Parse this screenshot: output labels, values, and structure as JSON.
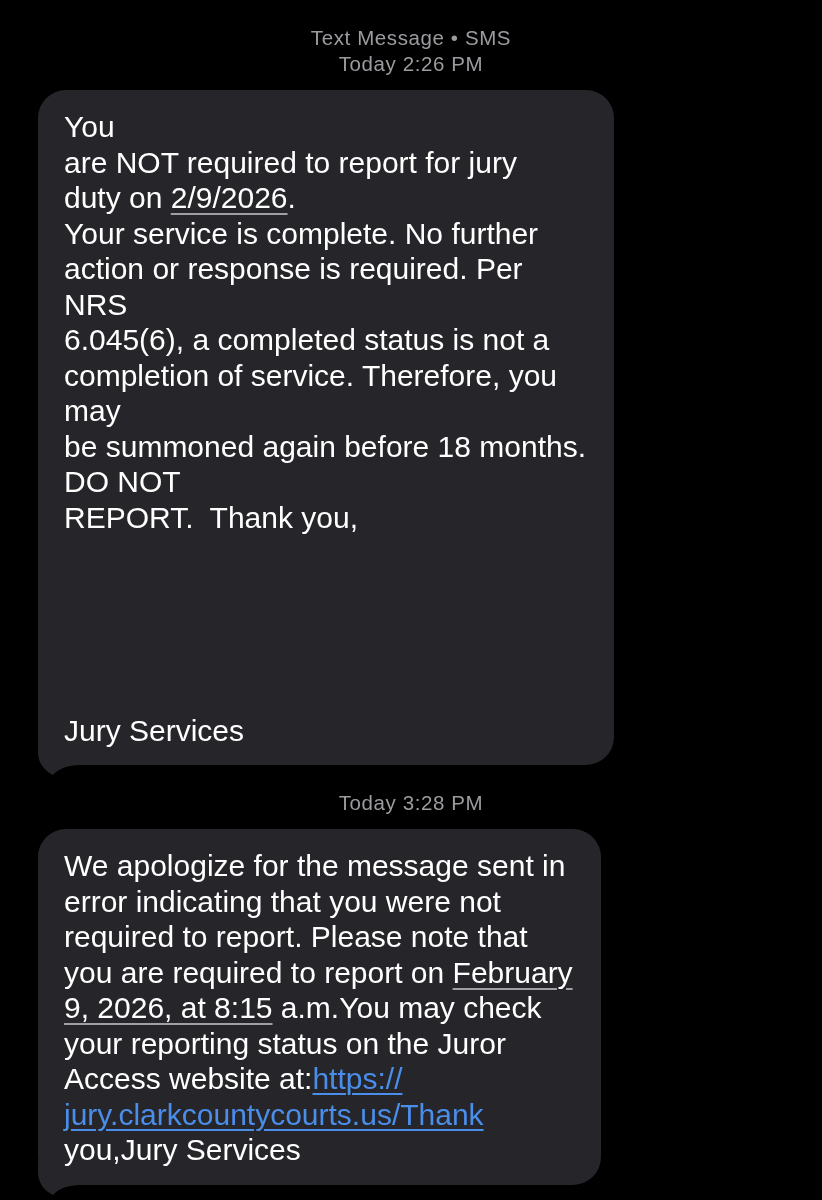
{
  "thread": [
    {
      "kind": "header",
      "service": "Text Message • SMS",
      "time": "Today 2:26 PM"
    },
    {
      "kind": "message",
      "tail": true,
      "paragraphs": [
        {
          "lines": [
            [
              {
                "kind": "text",
                "text": "You"
              }
            ],
            [
              {
                "kind": "text",
                "text": "are NOT required to report for jury"
              }
            ],
            [
              {
                "kind": "text",
                "text": "duty on "
              },
              {
                "kind": "date",
                "text": "2/9/2026"
              },
              {
                "kind": "text",
                "text": "."
              }
            ],
            [
              {
                "kind": "text",
                "text": "Your service is complete. No further"
              }
            ],
            [
              {
                "kind": "text",
                "text": "action or response is required. Per"
              }
            ],
            [
              {
                "kind": "text",
                "text": "NRS"
              }
            ],
            [
              {
                "kind": "text",
                "text": "6.045(6), a completed status is not a"
              }
            ],
            [
              {
                "kind": "text",
                "text": "completion of service. Therefore, you"
              }
            ],
            [
              {
                "kind": "text",
                "text": "may"
              }
            ],
            [
              {
                "kind": "text",
                "text": "be summoned again before 18 months."
              }
            ],
            [
              {
                "kind": "text",
                "text": "DO NOT"
              }
            ],
            [
              {
                "kind": "text",
                "text": "REPORT.  Thank you,"
              }
            ]
          ]
        },
        {
          "lines": [
            [
              {
                "kind": "text",
                "text": "Jury Services"
              }
            ]
          ]
        }
      ]
    },
    {
      "kind": "header",
      "time": "Today 3:28 PM"
    },
    {
      "kind": "message",
      "tail": true,
      "paragraphs": [
        {
          "lines": [
            [
              {
                "kind": "text",
                "text": "We apologize for the message sent in"
              }
            ],
            [
              {
                "kind": "text",
                "text": "error indicating that you were not"
              }
            ],
            [
              {
                "kind": "text",
                "text": "required to report. Please note that"
              }
            ],
            [
              {
                "kind": "text",
                "text": "you are required to report on "
              },
              {
                "kind": "date",
                "text": "February"
              }
            ],
            [
              {
                "kind": "date",
                "text": "9, 2026, at 8:15"
              },
              {
                "kind": "text",
                "text": " a.m.You may check"
              }
            ],
            [
              {
                "kind": "text",
                "text": "your reporting status on the Juror"
              }
            ],
            [
              {
                "kind": "text",
                "text": "Access website at:"
              },
              {
                "kind": "link",
                "text": "https://"
              }
            ],
            [
              {
                "kind": "link",
                "text": "jury.clarkcountycourts.us/Thank"
              }
            ],
            [
              {
                "kind": "text",
                "text": "you,Jury Services"
              }
            ]
          ]
        }
      ]
    }
  ]
}
